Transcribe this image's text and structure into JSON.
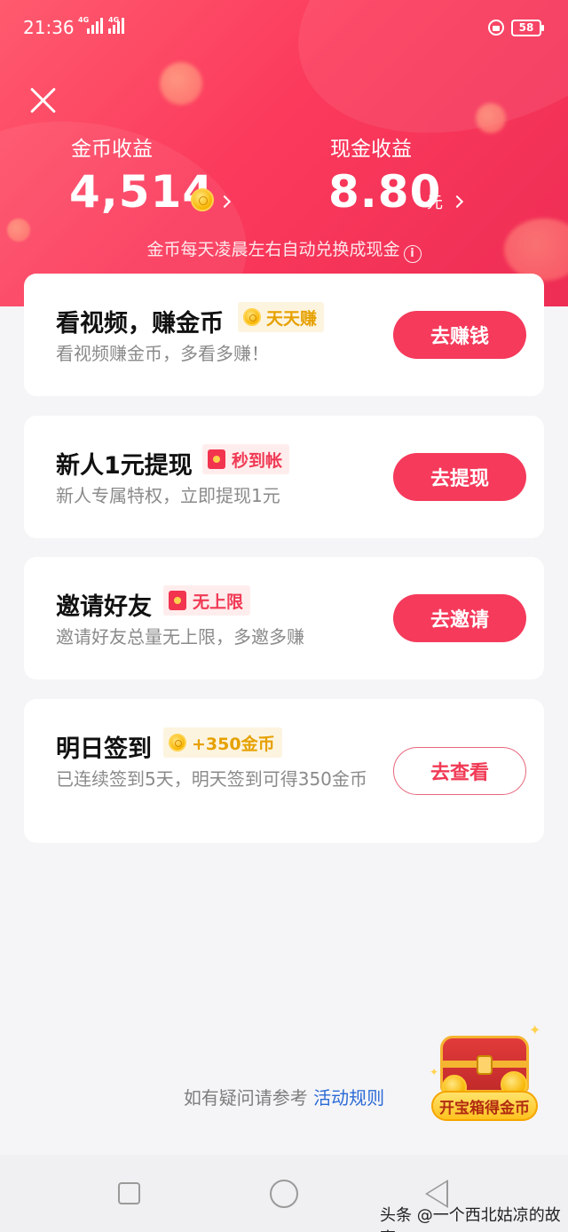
{
  "status_bar": {
    "time": "21:36",
    "network_1": "4G",
    "network_2": "4G",
    "battery": "58"
  },
  "header": {
    "coin_income": {
      "label": "金币收益",
      "value": "4,514"
    },
    "cash_income": {
      "label": "现金收益",
      "value": "8.80",
      "unit": "元"
    },
    "note": "金币每天凌晨左右自动兑换成现金",
    "info_glyph": "i"
  },
  "tasks": [
    {
      "title": "看视频，赚金币",
      "tag": "天天赚",
      "tag_icon": "coin-icon",
      "desc": "看视频赚金币，多看多赚！",
      "button": "去赚钱"
    },
    {
      "title": "新人1元提现",
      "tag": "秒到帐",
      "tag_icon": "red-envelope-icon",
      "desc": "新人专属特权，立即提现1元",
      "button": "去提现"
    },
    {
      "title": "邀请好友",
      "tag": "无上限",
      "tag_icon": "red-envelope-icon",
      "desc": "邀请好友总量无上限，多邀多赚",
      "button": "去邀请"
    },
    {
      "title": "明日签到",
      "tag": "+350金币",
      "tag_icon": "coin-icon",
      "desc": "已连续签到5天，明天签到可得350金币",
      "button": "去查看"
    }
  ],
  "footer": {
    "question_text": "如有疑问请参考 ",
    "rules_link": "活动规则"
  },
  "treasure_chest": {
    "label": "开宝箱得金币"
  },
  "watermark": "头条 @一个西北姑凉的故事",
  "colors": {
    "primary": "#f53a5b",
    "gold": "#e6a100",
    "link": "#2a6ad6"
  }
}
